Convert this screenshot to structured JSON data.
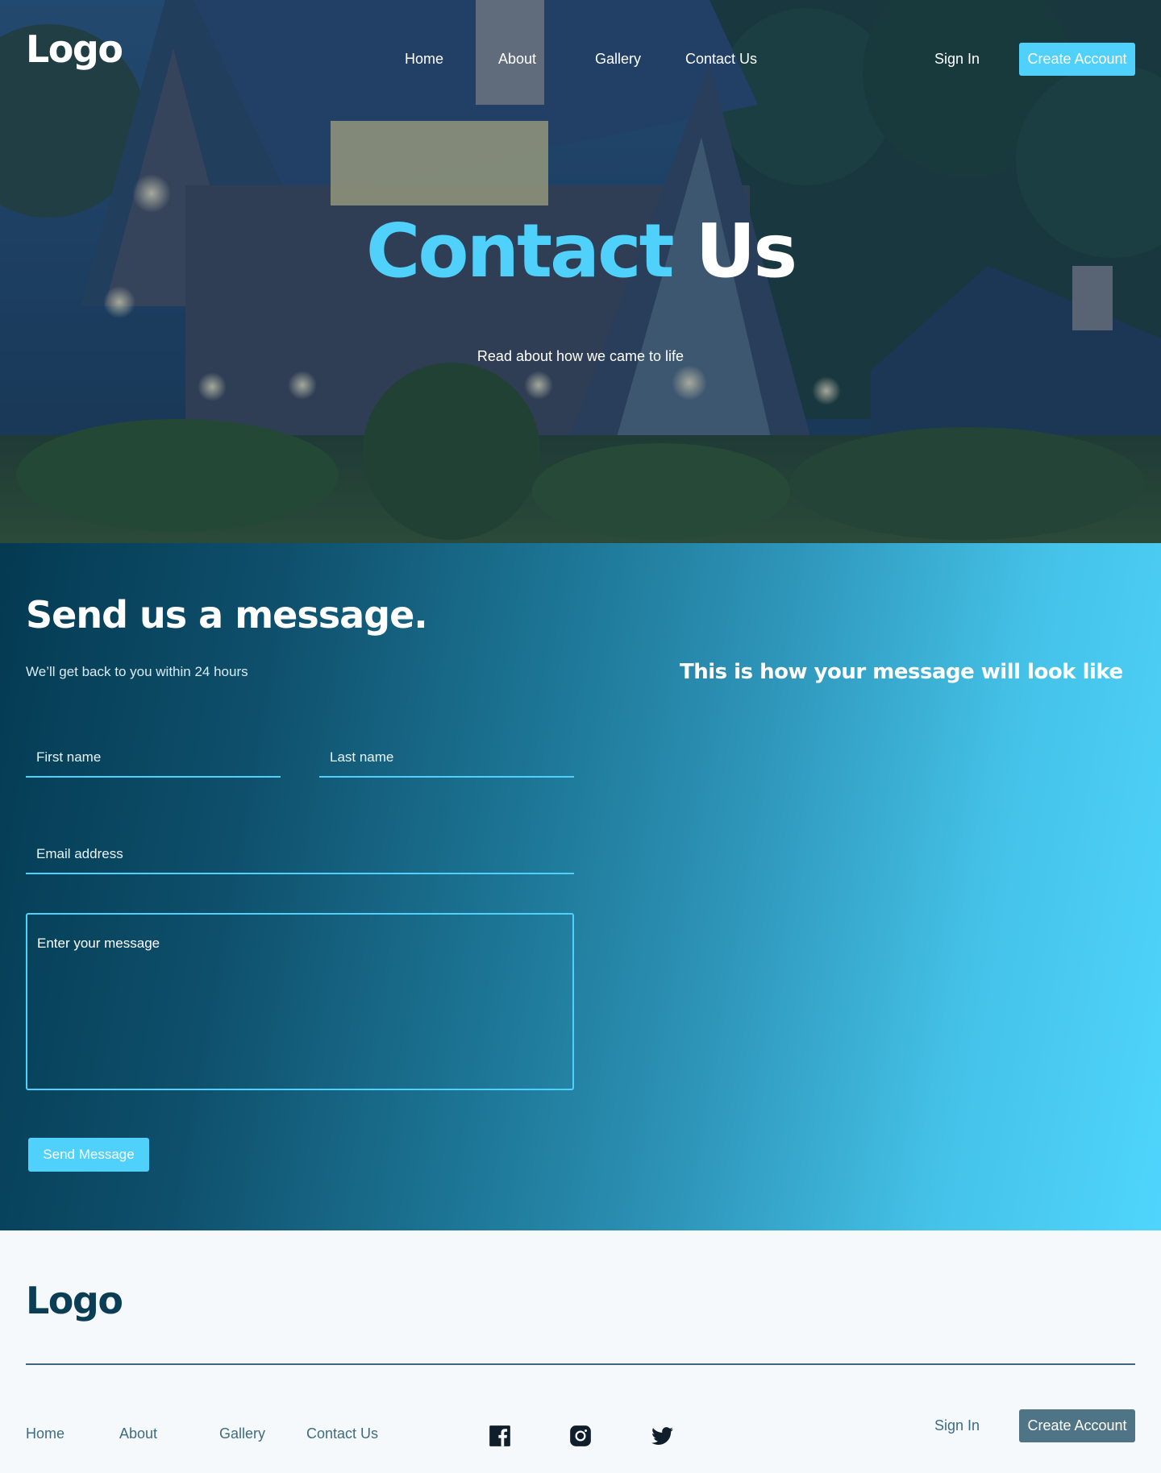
{
  "header": {
    "logo": "Logo",
    "nav": [
      {
        "label": "Home"
      },
      {
        "label": "About"
      },
      {
        "label": "Gallery"
      },
      {
        "label": "Contact Us"
      }
    ],
    "sign_in": "Sign In",
    "create_account": "Create Account"
  },
  "hero": {
    "title_accent": "Contact",
    "title_rest": " Us",
    "subtitle": "Read about how we came to life"
  },
  "contact_form": {
    "title": "Send us a message.",
    "subtitle": "We’ll get back to you within 24 hours",
    "first_name_placeholder": "First name",
    "last_name_placeholder": "Last name",
    "email_placeholder": "Email address",
    "message_placeholder": "Enter your message",
    "send_label": "Send Message"
  },
  "preview": {
    "title": "This is how your message will look like"
  },
  "footer": {
    "logo": "Logo",
    "nav": [
      {
        "label": "Home"
      },
      {
        "label": "About"
      },
      {
        "label": "Gallery"
      },
      {
        "label": "Contact Us"
      }
    ],
    "social_icons": [
      "facebook-icon",
      "instagram-icon",
      "twitter-icon"
    ],
    "sign_in": "Sign In",
    "create_account": "Create Account"
  },
  "colors": {
    "accent": "#4fd1fb",
    "dark_navy": "#0b3d55",
    "footer_button": "#4f7486"
  }
}
